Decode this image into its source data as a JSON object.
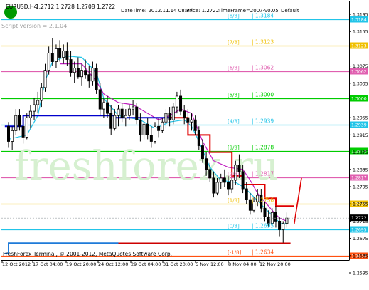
{
  "header": {
    "symbol": "EURUSD,H4",
    "ohlc": "1.2712 1.2728 1.2708 1.2722",
    "datetime": "DateTime: 2012.11.14 08:37",
    "price": "Price: 1.2722",
    "timeframe": "TimeFrame=2007-v0.05",
    "preset": "Default",
    "script_version": "Script version = 2.1.04"
  },
  "watermark": "freshforex.ru",
  "footer": "FreshForex Terminal, © 2001-2012, MetaQuotes Software Corp.",
  "colors": {
    "background": "#ffffff",
    "candle": "#000000",
    "ma_cyan": "#22c4e8",
    "ma_magenta": "#c020c0",
    "trend_blue": "#0000cc",
    "trend_red": "#e00000",
    "stop_blue": "#1e7ad8",
    "stop_red": "#cc0000",
    "watermark": "#d6f0d0"
  },
  "chart_data": {
    "type": "candlestick",
    "y_range": [
      1.2595,
      1.3195
    ],
    "price_axis_ticks": [
      "1.3195",
      "1.3184",
      "1.3155",
      "1.3123",
      "1.3075",
      "1.3062",
      "1.3035",
      "1.3000",
      "1.2955",
      "1.2939",
      "1.2915",
      "1.2878",
      "1.2875",
      "1.2835",
      "1.2817",
      "1.2795",
      "1.2756",
      "1.2755",
      "1.2722",
      "1.2715",
      "1.2695",
      "1.2675",
      "1.2634",
      "1.2635",
      "1.2595"
    ],
    "time_axis_labels": [
      "12 Oct 2012",
      "17 Oct 04:00",
      "19 Oct 20:00",
      "24 Oct 12:00",
      "29 Oct 04:00",
      "31 Oct 20:00",
      "5 Nov 12:00",
      "8 Nov 04:00",
      "12 Nov 20:00"
    ],
    "murrey_levels": [
      {
        "label": "[8/8]",
        "value": 1.3184,
        "color": "#22c4e8"
      },
      {
        "label": "[7/8]",
        "value": 1.3123,
        "color": "#f0c000"
      },
      {
        "label": "[6/8]",
        "value": 1.3062,
        "color": "#e060b0"
      },
      {
        "label": "[5/8]",
        "value": 1.3,
        "color": "#00cc00"
      },
      {
        "label": "[4/8]",
        "value": 1.2939,
        "color": "#22c4e8"
      },
      {
        "label": "[3/8]",
        "value": 1.2878,
        "color": "#00cc00"
      },
      {
        "label": "[2/8]",
        "value": 1.2817,
        "color": "#e060b0"
      },
      {
        "label": "[1/8]",
        "value": 1.2756,
        "color": "#f0c000"
      },
      {
        "label": "[0/8]",
        "value": 1.2695,
        "color": "#22c4e8"
      },
      {
        "label": "[-1/8]",
        "value": 1.2634,
        "color": "#ff5010"
      }
    ],
    "current_price": {
      "label": "1.2722",
      "value": 1.2722
    },
    "candles": [
      [
        1.2935,
        1.2945,
        1.2885,
        1.29
      ],
      [
        1.29,
        1.2935,
        1.288,
        1.2925
      ],
      [
        1.2925,
        1.2975,
        1.2915,
        1.296
      ],
      [
        1.296,
        1.2975,
        1.2925,
        1.2935
      ],
      [
        1.2935,
        1.2955,
        1.2895,
        1.291
      ],
      [
        1.291,
        1.2965,
        1.2905,
        1.2955
      ],
      [
        1.2955,
        1.2985,
        1.293,
        1.297
      ],
      [
        1.297,
        1.3,
        1.295,
        1.2985
      ],
      [
        1.2985,
        1.3015,
        1.2965,
        1.2995
      ],
      [
        1.2995,
        1.3035,
        1.298,
        1.3025
      ],
      [
        1.3025,
        1.308,
        1.3015,
        1.3065
      ],
      [
        1.3065,
        1.312,
        1.3055,
        1.3105
      ],
      [
        1.3105,
        1.314,
        1.3075,
        1.3085
      ],
      [
        1.3085,
        1.3125,
        1.307,
        1.3115
      ],
      [
        1.3115,
        1.3135,
        1.3085,
        1.3095
      ],
      [
        1.3095,
        1.3125,
        1.308,
        1.311
      ],
      [
        1.311,
        1.313,
        1.3075,
        1.309
      ],
      [
        1.309,
        1.311,
        1.305,
        1.306
      ],
      [
        1.306,
        1.3085,
        1.3035,
        1.307
      ],
      [
        1.307,
        1.3095,
        1.3045,
        1.305
      ],
      [
        1.305,
        1.308,
        1.303,
        1.3065
      ],
      [
        1.3065,
        1.309,
        1.3045,
        1.3055
      ],
      [
        1.3055,
        1.3075,
        1.3025,
        1.304
      ],
      [
        1.304,
        1.3085,
        1.303,
        1.307
      ],
      [
        1.307,
        1.308,
        1.301,
        1.302
      ],
      [
        1.302,
        1.3035,
        1.296,
        1.2975
      ],
      [
        1.2975,
        1.3,
        1.2955,
        1.299
      ],
      [
        1.299,
        1.3005,
        1.2955,
        1.2965
      ],
      [
        1.2965,
        1.2985,
        1.2915,
        1.293
      ],
      [
        1.293,
        1.2975,
        1.2925,
        1.296
      ],
      [
        1.296,
        1.2985,
        1.2935,
        1.2975
      ],
      [
        1.2975,
        1.299,
        1.2945,
        1.2955
      ],
      [
        1.2955,
        1.2975,
        1.2935,
        1.296
      ],
      [
        1.296,
        1.2985,
        1.295,
        1.2975
      ],
      [
        1.2975,
        1.2995,
        1.296,
        1.298
      ],
      [
        1.298,
        1.299,
        1.294,
        1.295
      ],
      [
        1.295,
        1.2965,
        1.29,
        1.2915
      ],
      [
        1.2915,
        1.295,
        1.2905,
        1.294
      ],
      [
        1.294,
        1.2955,
        1.2905,
        1.2915
      ],
      [
        1.2915,
        1.2935,
        1.2885,
        1.29
      ],
      [
        1.29,
        1.2945,
        1.2895,
        1.2935
      ],
      [
        1.2935,
        1.2955,
        1.291,
        1.2925
      ],
      [
        1.2925,
        1.2955,
        1.292,
        1.2945
      ],
      [
        1.2945,
        1.2975,
        1.293,
        1.2965
      ],
      [
        1.2965,
        1.298,
        1.2935,
        1.295
      ],
      [
        1.295,
        1.299,
        1.294,
        1.298
      ],
      [
        1.298,
        1.3015,
        1.2965,
        1.3005
      ],
      [
        1.3005,
        1.302,
        1.296,
        1.297
      ],
      [
        1.297,
        1.2985,
        1.294,
        1.2955
      ],
      [
        1.2955,
        1.2975,
        1.2935,
        1.2945
      ],
      [
        1.2945,
        1.2965,
        1.2925,
        1.295
      ],
      [
        1.295,
        1.296,
        1.2915,
        1.2925
      ],
      [
        1.2925,
        1.2935,
        1.288,
        1.289
      ],
      [
        1.289,
        1.2905,
        1.285,
        1.286
      ],
      [
        1.286,
        1.2875,
        1.282,
        1.2835
      ],
      [
        1.2835,
        1.285,
        1.2805,
        1.2815
      ],
      [
        1.2815,
        1.283,
        1.277,
        1.278
      ],
      [
        1.278,
        1.2815,
        1.2775,
        1.2805
      ],
      [
        1.2805,
        1.2825,
        1.279,
        1.2815
      ],
      [
        1.2815,
        1.2835,
        1.2795,
        1.2805
      ],
      [
        1.2805,
        1.282,
        1.2775,
        1.279
      ],
      [
        1.279,
        1.2815,
        1.278,
        1.281
      ],
      [
        1.281,
        1.2855,
        1.28,
        1.2845
      ],
      [
        1.2845,
        1.287,
        1.2815,
        1.283
      ],
      [
        1.283,
        1.2845,
        1.278,
        1.279
      ],
      [
        1.279,
        1.2805,
        1.2755,
        1.2765
      ],
      [
        1.2765,
        1.278,
        1.273,
        1.274
      ],
      [
        1.274,
        1.277,
        1.2735,
        1.276
      ],
      [
        1.276,
        1.279,
        1.275,
        1.2775
      ],
      [
        1.2775,
        1.279,
        1.2735,
        1.2745
      ],
      [
        1.2745,
        1.276,
        1.2715,
        1.2725
      ],
      [
        1.2725,
        1.274,
        1.27,
        1.271
      ],
      [
        1.271,
        1.2745,
        1.2705,
        1.2735
      ],
      [
        1.2735,
        1.275,
        1.27,
        1.2715
      ],
      [
        1.2715,
        1.2725,
        1.268,
        1.2695
      ],
      [
        1.2695,
        1.2715,
        1.2665,
        1.271
      ],
      [
        1.271,
        1.2735,
        1.27,
        1.2722
      ]
    ],
    "lines": {
      "ma_cyan": [
        [
          0,
          1.2905
        ],
        [
          5,
          1.2915
        ],
        [
          8,
          1.296
        ],
        [
          10,
          1.304
        ],
        [
          12,
          1.3085
        ],
        [
          16,
          1.3098
        ],
        [
          20,
          1.3095
        ],
        [
          24,
          1.306
        ],
        [
          26,
          1.3
        ],
        [
          30,
          1.296
        ],
        [
          36,
          1.295
        ],
        [
          40,
          1.293
        ],
        [
          44,
          1.2945
        ],
        [
          48,
          1.295
        ],
        [
          50,
          1.2935
        ],
        [
          52,
          1.29
        ],
        [
          55,
          1.284
        ],
        [
          58,
          1.281
        ],
        [
          62,
          1.2805
        ],
        [
          64,
          1.2795
        ],
        [
          66,
          1.278
        ],
        [
          70,
          1.2745
        ],
        [
          73,
          1.272
        ],
        [
          75,
          1.2705
        ],
        [
          76,
          1.2712
        ]
      ],
      "ma_magenta": [
        [
          14,
          1.308
        ],
        [
          20,
          1.308
        ],
        [
          24,
          1.304
        ],
        [
          26,
          1.301
        ],
        [
          30,
          1.299
        ],
        [
          34,
          1.2985
        ],
        [
          38,
          1.2965
        ],
        [
          41,
          1.295
        ],
        [
          44,
          1.296
        ],
        [
          47,
          1.2975
        ],
        [
          50,
          1.2965
        ],
        [
          53,
          1.29
        ],
        [
          56,
          1.2855
        ],
        [
          60,
          1.284
        ],
        [
          64,
          1.2835
        ],
        [
          66,
          1.281
        ],
        [
          68,
          1.278
        ],
        [
          70,
          1.276
        ],
        [
          72,
          1.274
        ],
        [
          74,
          1.2722
        ],
        [
          76,
          1.2715
        ]
      ],
      "trend_blue": [
        [
          -1,
          1.2935
        ],
        [
          4,
          1.2935
        ],
        [
          4,
          1.296
        ],
        [
          29,
          1.296
        ],
        [
          29,
          1.2955
        ],
        [
          45,
          1.2955
        ]
      ],
      "trend_red": [
        [
          44,
          1.2955
        ],
        [
          49,
          1.2955
        ],
        [
          49,
          1.2915
        ],
        [
          55,
          1.2915
        ],
        [
          55,
          1.2875
        ],
        [
          61,
          1.2875
        ],
        [
          61,
          1.282
        ],
        [
          64,
          1.282
        ],
        [
          64,
          1.28
        ],
        [
          70,
          1.28
        ],
        [
          70,
          1.2768
        ],
        [
          73,
          1.2768
        ],
        [
          73,
          1.275
        ],
        [
          78,
          1.275
        ]
      ],
      "projection_red": [
        [
          78,
          1.2708
        ],
        [
          80,
          1.2815
        ]
      ],
      "stop_blue": [
        [
          -1,
          1.264
        ],
        [
          0,
          1.264
        ],
        [
          0,
          1.2664
        ],
        [
          30,
          1.2664
        ]
      ],
      "stop_red": [
        [
          30,
          1.2664
        ],
        [
          77,
          1.2664
        ]
      ]
    }
  }
}
